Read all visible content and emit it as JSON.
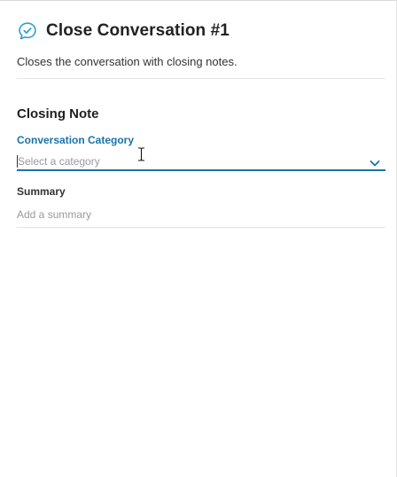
{
  "header": {
    "title": "Close Conversation #1",
    "icon": "chat-check-icon",
    "icon_color": "#2a9fd6"
  },
  "description": "Closes the conversation with closing notes.",
  "closing_note": {
    "section_title": "Closing Note",
    "category": {
      "label": "Conversation Category",
      "placeholder": "Select a category",
      "active_color": "#1a73a8"
    },
    "summary": {
      "label": "Summary",
      "placeholder": "Add a summary"
    }
  }
}
